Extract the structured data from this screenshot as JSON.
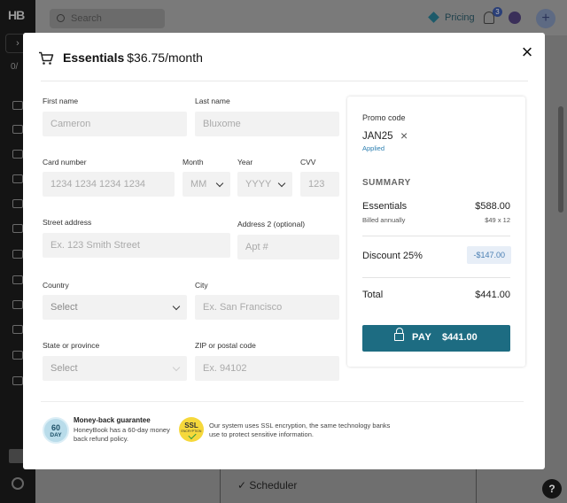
{
  "background": {
    "logo": "HB",
    "search_placeholder": "Search",
    "pricing_label": "Pricing",
    "notification_count": "3",
    "sidebar_counter": "0/",
    "scheduler_label": "Scheduler",
    "help_label": "?"
  },
  "modal": {
    "plan_name": "Essentials",
    "plan_price": "$36.75/month",
    "close_label": "×"
  },
  "form": {
    "first_name": {
      "label": "First name",
      "placeholder": "Cameron"
    },
    "last_name": {
      "label": "Last name",
      "placeholder": "Bluxome"
    },
    "card_number": {
      "label": "Card number",
      "placeholder": "1234 1234 1234 1234"
    },
    "month": {
      "label": "Month",
      "value": "MM"
    },
    "year": {
      "label": "Year",
      "value": "YYYY"
    },
    "cvv": {
      "label": "CVV",
      "placeholder": "123"
    },
    "street": {
      "label": "Street address",
      "placeholder": "Ex. 123 Smith Street"
    },
    "address2": {
      "label": "Address 2 (optional)",
      "placeholder": "Apt #"
    },
    "country": {
      "label": "Country",
      "value": "Select"
    },
    "city": {
      "label": "City",
      "placeholder": "Ex. San Francisco"
    },
    "state": {
      "label": "State or province",
      "value": "Select"
    },
    "zip": {
      "label": "ZIP or postal code",
      "placeholder": "Ex. 94102"
    }
  },
  "guarantee": {
    "badge_number": "60",
    "badge_unit": "DAY",
    "title": "Money-back guarantee",
    "text": "HoneyBook has a 60-day money back refund policy."
  },
  "ssl": {
    "badge_label": "SSL",
    "badge_sub": "ENCRYPTION",
    "text": "Our system uses SSL encryption, the same technology banks use to protect sensitive information."
  },
  "summary": {
    "promo_label": "Promo code",
    "promo_code": "JAN25",
    "promo_remove": "×",
    "promo_status": "Applied",
    "title": "SUMMARY",
    "plan_label": "Essentials",
    "plan_total": "$588.00",
    "billing_note": "Billed annually",
    "billing_calc": "$49 x 12",
    "discount_label": "Discount 25%",
    "discount_value": "-$147.00",
    "total_label": "Total",
    "total_value": "$441.00",
    "pay_label": "PAY",
    "pay_amount": "$441.00"
  },
  "colors": {
    "pay_button": "#1d6c82",
    "applied_text": "#2c7fb0",
    "discount_pill_bg": "#e7eef7",
    "ssl_badge": "#f6d83b",
    "day_badge": "#b9dcea"
  }
}
